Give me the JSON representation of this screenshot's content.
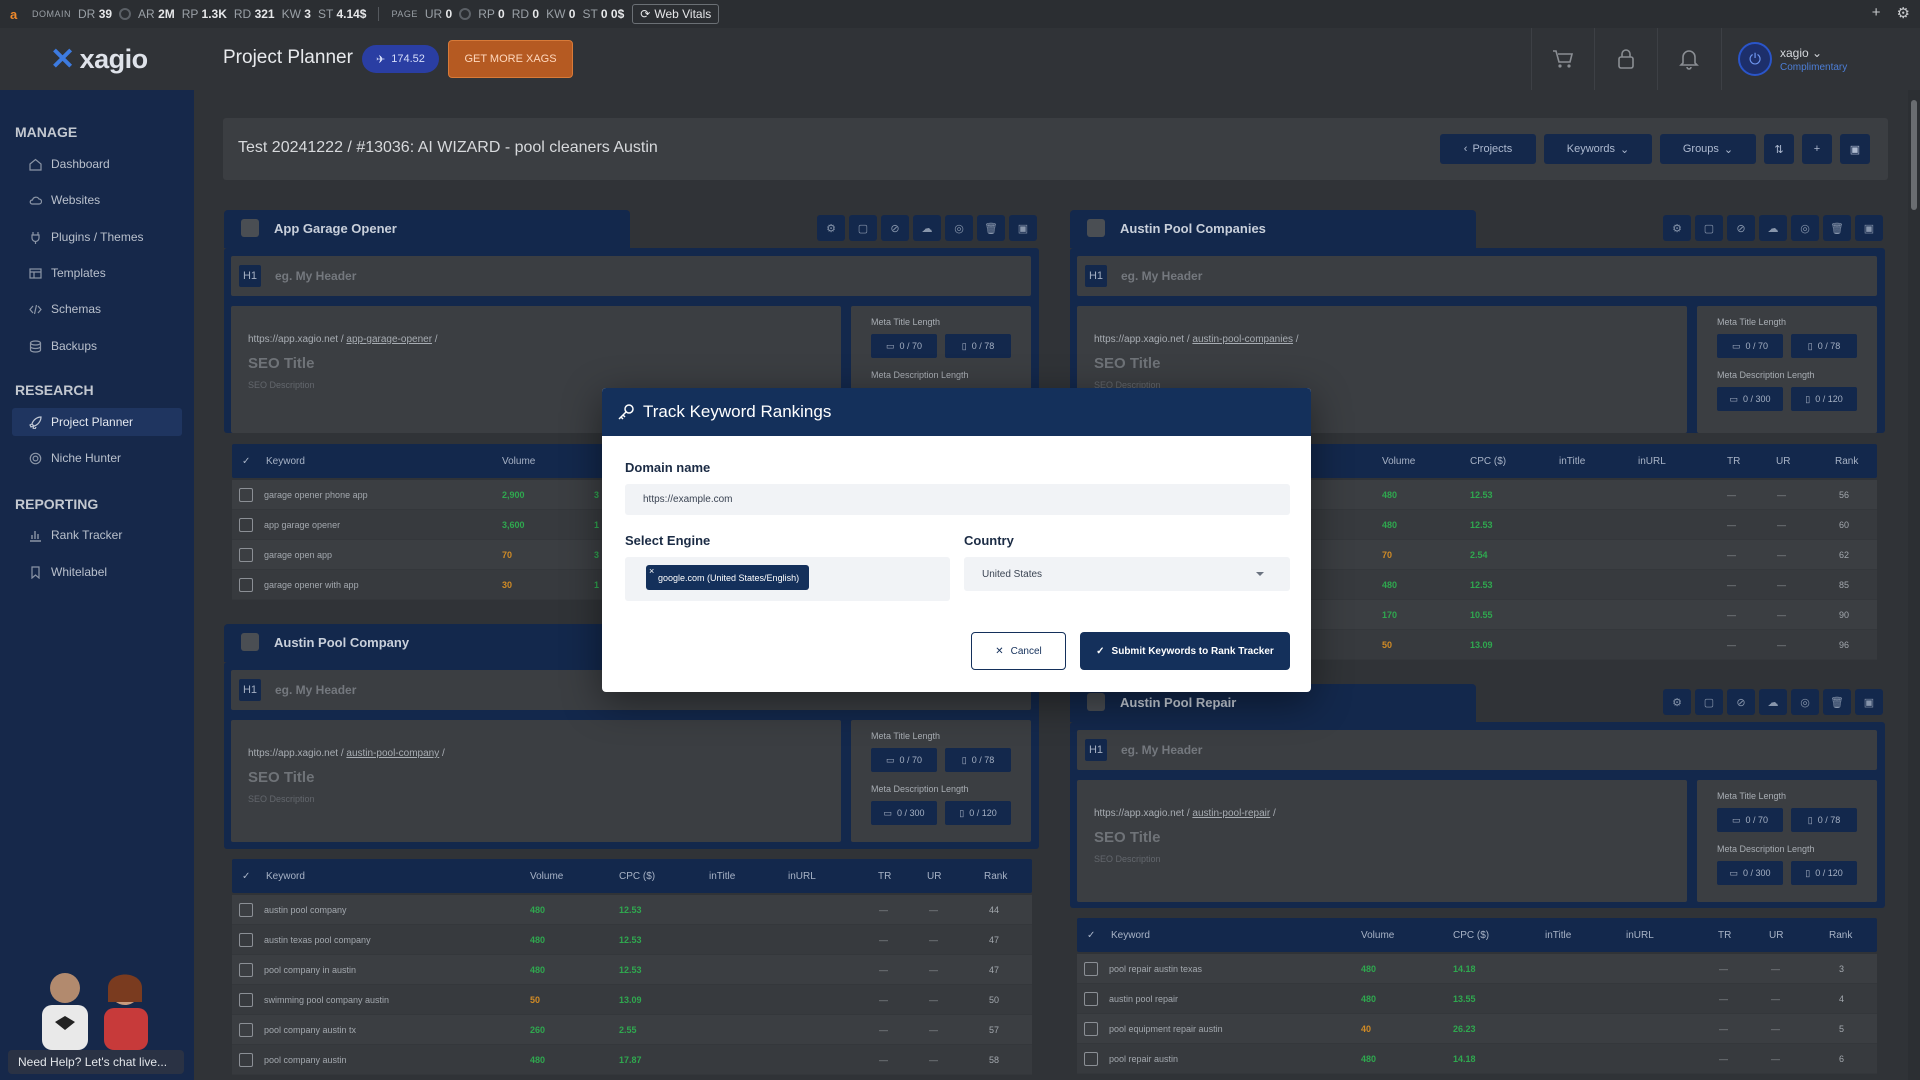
{
  "seobar": {
    "domain_tag": "DOMAIN",
    "domain_metrics": [
      {
        "k": "DR",
        "v": "39"
      },
      {
        "k": "AR",
        "v": "2M"
      },
      {
        "k": "RP",
        "v": "1.3K"
      },
      {
        "k": "RD",
        "v": "321"
      },
      {
        "k": "KW",
        "v": "3"
      },
      {
        "k": "ST",
        "v": "4.14$"
      }
    ],
    "page_tag": "PAGE",
    "page_metrics": [
      {
        "k": "UR",
        "v": "0"
      },
      {
        "k": "RP",
        "v": "0"
      },
      {
        "k": "RD",
        "v": "0"
      },
      {
        "k": "KW",
        "v": "0"
      },
      {
        "k": "ST",
        "v": "0 0$"
      }
    ],
    "web_vitals": "Web Vitals"
  },
  "header": {
    "logo": "xagio",
    "title": "Project Planner",
    "xags": "174.52",
    "get_more": "GET MORE XAGS",
    "user_name": "xagio",
    "user_plan": "Complimentary"
  },
  "sidebar": {
    "manage": "MANAGE",
    "research": "RESEARCH",
    "reporting": "REPORTING",
    "items": [
      {
        "label": "Dashboard",
        "icon": "home-icon"
      },
      {
        "label": "Websites",
        "icon": "cloud-icon"
      },
      {
        "label": "Plugins / Themes",
        "icon": "plug-icon"
      },
      {
        "label": "Templates",
        "icon": "template-icon"
      },
      {
        "label": "Schemas",
        "icon": "code-icon"
      },
      {
        "label": "Backups",
        "icon": "database-icon"
      },
      {
        "label": "Project Planner",
        "icon": "rocket-icon"
      },
      {
        "label": "Niche Hunter",
        "icon": "target-icon"
      },
      {
        "label": "Rank Tracker",
        "icon": "bar-chart-icon"
      },
      {
        "label": "Whitelabel",
        "icon": "bookmark-icon"
      }
    ],
    "chat": "Need Help? Let's chat live..."
  },
  "project": {
    "title": "Test 20241222 / #13036: AI WIZARD - pool cleaners Austin",
    "projects_btn": "Projects",
    "keywords_btn": "Keywords",
    "groups_btn": "Groups"
  },
  "common": {
    "h1": "H1",
    "header_placeholder": "eg. My Header",
    "url_base": "https://app.xagio.net /",
    "seo_title": "SEO Title",
    "seo_desc": "SEO Description",
    "meta_title_len": "Meta Title Length",
    "meta_desc_len": "Meta Description Length",
    "mt_desktop": "0 / 70",
    "mt_mobile": "0 / 78",
    "md_desktop": "0 / 300",
    "md_mobile": "0 / 120",
    "cols": [
      "Keyword",
      "Volume",
      "CPC ($)",
      "inTitle",
      "inURL",
      "TR",
      "UR",
      "Rank"
    ]
  },
  "groups": [
    {
      "name": "App Garage Opener",
      "slug": "app-garage-opener",
      "rows": [
        {
          "kw": "garage opener phone app",
          "vol": "2,900",
          "cpc": "3",
          "rank": ""
        },
        {
          "kw": "app garage opener",
          "vol": "3,600",
          "cpc": "1",
          "rank": ""
        },
        {
          "kw": "garage open app",
          "vol": "70",
          "cpc": "3",
          "rank": ""
        },
        {
          "kw": "garage opener with app",
          "vol": "30",
          "cpc": "1",
          "rank": ""
        }
      ]
    },
    {
      "name": "Austin Pool Companies",
      "slug": "austin-pool-companies",
      "rows": [
        {
          "kw": "",
          "vol": "480",
          "cpc": "12.53",
          "rank": "56"
        },
        {
          "kw": "",
          "vol": "480",
          "cpc": "12.53",
          "rank": "60"
        },
        {
          "kw": "",
          "vol": "70",
          "cpc": "2.54",
          "rank": "62"
        },
        {
          "kw": "",
          "vol": "480",
          "cpc": "12.53",
          "rank": "85"
        },
        {
          "kw": "",
          "vol": "170",
          "cpc": "10.55",
          "rank": "90"
        },
        {
          "kw": "",
          "vol": "50",
          "cpc": "13.09",
          "rank": "96"
        }
      ]
    },
    {
      "name": "Austin Pool Company",
      "slug": "austin-pool-company",
      "rows": [
        {
          "kw": "austin pool company",
          "vol": "480",
          "cpc": "12.53",
          "rank": "44"
        },
        {
          "kw": "austin texas pool company",
          "vol": "480",
          "cpc": "12.53",
          "rank": "47"
        },
        {
          "kw": "pool company in austin",
          "vol": "480",
          "cpc": "12.53",
          "rank": "47"
        },
        {
          "kw": "swimming pool company austin",
          "vol": "50",
          "cpc": "13.09",
          "rank": "50"
        },
        {
          "kw": "pool company austin tx",
          "vol": "260",
          "cpc": "2.55",
          "rank": "57"
        },
        {
          "kw": "pool company austin",
          "vol": "480",
          "cpc": "17.87",
          "rank": "58"
        }
      ]
    },
    {
      "name": "Austin Pool Repair",
      "slug": "austin-pool-repair",
      "rows": [
        {
          "kw": "pool repair austin texas",
          "vol": "480",
          "cpc": "14.18",
          "rank": "3"
        },
        {
          "kw": "austin pool repair",
          "vol": "480",
          "cpc": "13.55",
          "rank": "4"
        },
        {
          "kw": "pool equipment repair austin",
          "vol": "40",
          "cpc": "26.23",
          "rank": "5"
        },
        {
          "kw": "pool repair austin",
          "vol": "480",
          "cpc": "14.18",
          "rank": "6"
        }
      ]
    }
  ],
  "modal": {
    "title": "Track Keyword Rankings",
    "domain_label": "Domain name",
    "domain_placeholder": "https://example.com",
    "engine_label": "Select Engine",
    "engine_chip": "google.com (United States/English)",
    "country_label": "Country",
    "country_value": "United States",
    "cancel": "Cancel",
    "submit": "Submit Keywords to Rank Tracker"
  },
  "colors": {
    "navy": "#14305b",
    "green": "#2fa84f",
    "orange": "#d18b25",
    "accent_orange": "#b55a22"
  }
}
